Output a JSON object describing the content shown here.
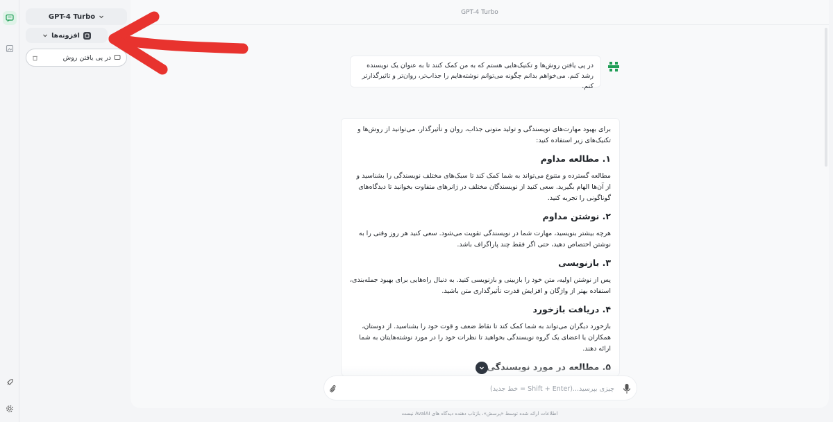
{
  "window": {
    "title": "GPT-4 Turbo"
  },
  "sidebar": {
    "model_label": "GPT-4 Turbo",
    "plugins_label": "افزونه‌ها",
    "new_chat_symbol": "+",
    "chats": [
      {
        "label": "در پی یافتن روش"
      }
    ],
    "collapse_symbol": "‹"
  },
  "conversation": {
    "user_message": "در پی یافتن روش‌ها و تکنیک‌هایی هستم که به من کمک کنند تا به عنوان یک نویسنده رشد کنم. می‌خواهم بدانم چگونه می‌توانم نوشته‌هایم را جذاب‌تر، روان‌تر و تاثیرگذارتر کنم.",
    "answer": {
      "intro": "برای بهبود مهارت‌های نویسندگی و تولید متونی جذاب، روان و تأثیرگذار، می‌توانید از روش‌ها و تکنیک‌های زیر استفاده کنید:",
      "sections": [
        {
          "heading": "۱. مطالعه مداوم",
          "body": "مطالعه گسترده و متنوع می‌تواند به شما کمک کند تا سبک‌های مختلف نویسندگی را بشناسید و از آن‌ها الهام بگیرید. سعی کنید از نویسندگان مختلف در ژانرهای متفاوت بخوانید تا دیدگاه‌های گوناگونی را تجربه کنید."
        },
        {
          "heading": "۲. نوشتن مداوم",
          "body": "هرچه بیشتر بنویسید، مهارت شما در نویسندگی تقویت می‌شود. سعی کنید هر روز وقتی را به نوشتن اختصاص دهید، حتی اگر فقط چند پاراگراف باشد."
        },
        {
          "heading": "۳. بازنویسی",
          "body": "پس از نوشتن اولیه، متن خود را بازبینی و بازنویسی کنید. به دنبال راه‌هایی برای بهبود جمله‌بندی، استفاده بهتر از واژگان و افزایش قدرت تأثیرگذاری متن باشید."
        },
        {
          "heading": "۴. دریافت بازخورد",
          "body": "بازخورد دیگران می‌تواند به شما کمک کند تا نقاط ضعف و قوت خود را بشناسید. از دوستان، همکاران یا اعضای یک گروه نویسندگی بخواهید تا نظرات خود را در مورد نوشته‌هایتان به شما ارائه دهند."
        },
        {
          "heading": "۵. مطالعه در مورد نویسندگی",
          "body": ""
        }
      ]
    }
  },
  "composer": {
    "placeholder": "چیزی بپرسید...(Shift + Enter = خط جدید)"
  },
  "footer": {
    "note": "اطلاعات ارائه شده توسط «پرسش»، بازتاب دهنده دیدگاه های AvalAI نیست"
  },
  "colors": {
    "accent_green": "#1f9d55",
    "annotation_red": "#e8332e",
    "dark_button": "#2f3640"
  },
  "icons": [
    "chat-icon",
    "image-icon",
    "plugin-icon",
    "chevron-down-icon",
    "plus-icon",
    "chat-bubble-icon",
    "trash-icon",
    "paperclip-icon",
    "microphone-icon",
    "settings-icon",
    "rocket-icon",
    "arrow-down-icon",
    "bot-avatar-icon"
  ]
}
